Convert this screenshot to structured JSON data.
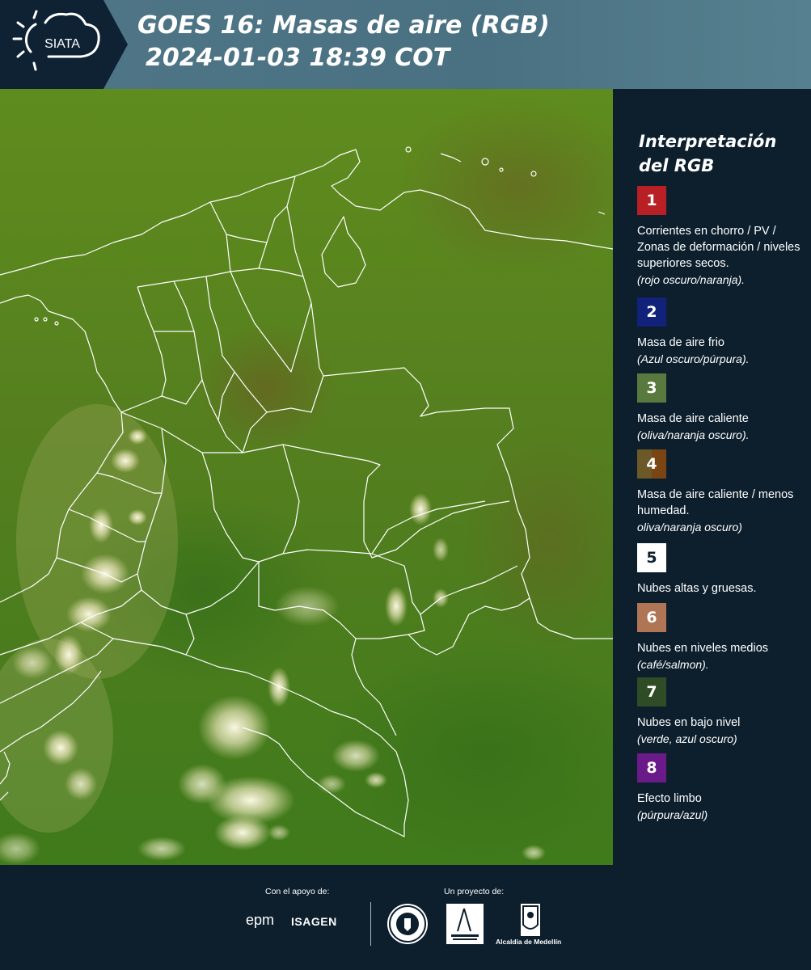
{
  "header": {
    "logo_text": "SIATA",
    "title_line1": "GOES 16: Masas de aire (RGB)",
    "title_line2": "2024-01-03 18:39 COT"
  },
  "legend": {
    "title_line1": "Interpretación",
    "title_line2": "del RGB",
    "items": [
      {
        "number": "1",
        "color": "#b82025",
        "text": "Corrientes en chorro / PV / Zonas de deformación / niveles superiores secos.",
        "note": "(rojo oscuro/naranja)."
      },
      {
        "number": "2",
        "color": "#12227a",
        "text": "Masa de aire frio",
        "note": "(Azul oscuro/púrpura)."
      },
      {
        "number": "3",
        "color": "#587a3f",
        "text": "Masa de aire caliente",
        "note": "(oliva/naranja oscuro)."
      },
      {
        "number": "4",
        "color": "#6b5a28",
        "color_right": "#7a4512",
        "text": "Masa de aire caliente / menos humedad.",
        "note": "oliva/naranja oscuro)"
      },
      {
        "number": "5",
        "color": "#ffffff",
        "text": "Nubes altas y gruesas.",
        "note": ""
      },
      {
        "number": "6",
        "color": "#b07555",
        "text": "Nubes en niveles medios",
        "note": "(café/salmon)."
      },
      {
        "number": "7",
        "color": "#2e4d26",
        "text": "Nubes en bajo nivel",
        "note": "(verde, azul oscuro)"
      },
      {
        "number": "8",
        "color": "#6b1a8a",
        "text": "Efecto limbo",
        "note": "(púrpura/azul)"
      }
    ]
  },
  "footer": {
    "support_label": "Con el apoyo de:",
    "project_label": "Un proyecto de:",
    "logos": {
      "epm": "epm",
      "isagen": "ISAGEN",
      "amva": "Área Metropolitana",
      "alcaldia": "Alcaldía de Medellín"
    }
  }
}
